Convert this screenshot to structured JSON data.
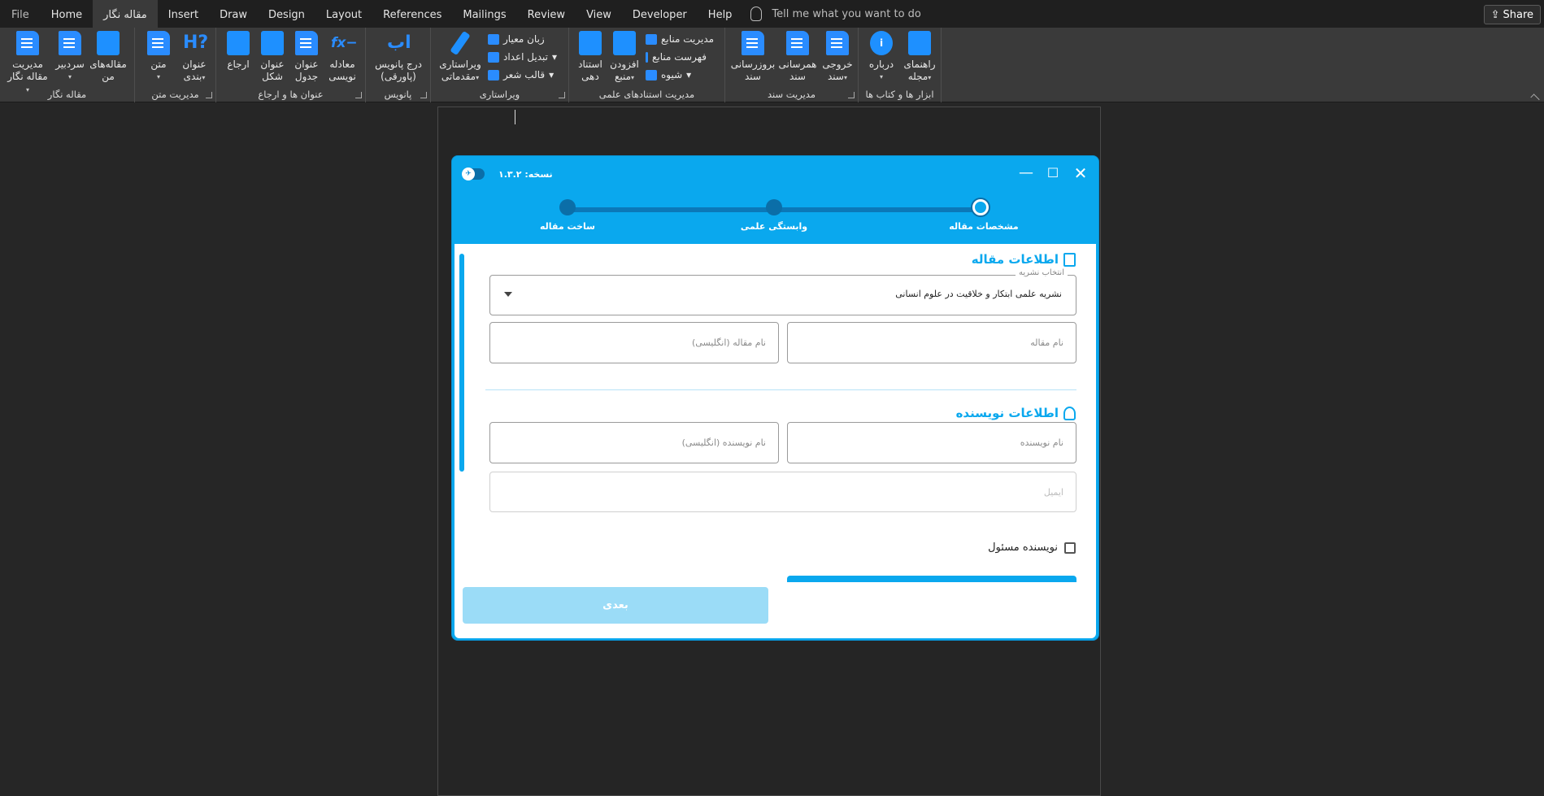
{
  "menubar": {
    "tabs": [
      "File",
      "Home",
      "مقاله نگار",
      "Insert",
      "Draw",
      "Design",
      "Layout",
      "References",
      "Mailings",
      "Review",
      "View",
      "Developer",
      "Help"
    ],
    "active_tab": "مقاله نگار",
    "tell_me": "Tell me what you want to do",
    "share": "Share"
  },
  "ribbon": {
    "groups": {
      "maghale": "مقاله نگار",
      "text": "مدیریت متن",
      "titles": "عنوان ها و ارجاع",
      "footnote": "پانویس",
      "edit": "ویراستاری",
      "citations": "مدیریت استنادهای علمی",
      "docmgmt": "مدیریت سند",
      "tools": "ابزار ها و کتاب ها"
    },
    "buttons": {
      "manage": "مدیریت",
      "manage2": "مقاله نگار",
      "editor": "سردبیر",
      "my1": "مقاله‌های",
      "my2": "من",
      "text": "متن",
      "heading1": "عنوان",
      "heading2": "بندی",
      "ref": "ارجاع",
      "fig1": "عنوان",
      "fig2": "شکل",
      "tbl1": "عنوان",
      "tbl2": "جدول",
      "eq1": "معادله",
      "eq2": "نویسی",
      "fn1": "درج پانویس",
      "fn2": "(پاورقی)",
      "pre1": "ویراستاری",
      "pre2": "مقدماتی",
      "lang": "زبان معیار",
      "num": "تبدیل اعداد",
      "poem": "قالب شعر",
      "cite1": "استناد",
      "cite2": "دهی",
      "addsrc1": "افزودن",
      "addsrc2": "منبع",
      "srcmgr": "مدیریت منابع",
      "srclist": "فهرست منابع",
      "style": "شیوه",
      "upd1": "بروزرسانی",
      "upd2": "سند",
      "sync1": "همرسانی",
      "sync2": "سند",
      "out1": "خروجی",
      "out2": "سند",
      "about": "درباره",
      "guide1": "راهنمای",
      "guide2": "مجله"
    }
  },
  "dialog": {
    "version": "نسخه: ۱.۳.۲",
    "steps": [
      "مشخصات مقاله",
      "وابستگی علمی",
      "ساخت مقاله"
    ],
    "active_step": 0,
    "article_section": "اطلاعات مقاله",
    "journal_label": "انتخاب نشریه",
    "journal_value": "نشریه علمی ابتکار و خلاقیت در علوم انسانی",
    "title_ph": "نام مقاله",
    "title_en_ph": "نام مقاله (انگلیسی)",
    "author_section": "اطلاعات نویسنده",
    "author_ph": "نام نویسنده",
    "author_en_ph": "نام نویسنده (انگلیسی)",
    "email_ph": "ایمیل",
    "corresponding": "نویسنده مسئول",
    "next": "بعدی"
  }
}
